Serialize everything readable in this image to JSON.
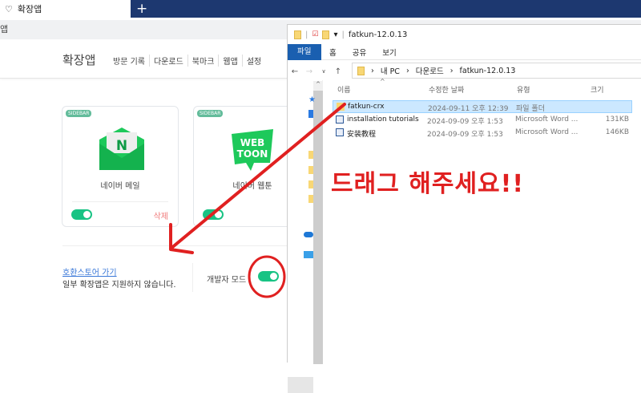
{
  "browser": {
    "tab_title": "확장앱",
    "new_tab": "+",
    "address": "앱"
  },
  "header": {
    "title": "확장앱",
    "nav": [
      "방문 기록",
      "다운로드",
      "북마크",
      "웹앱",
      "설정"
    ]
  },
  "cards": [
    {
      "badge": "SIDEBAR",
      "name": "네이버 메일",
      "enabled": true,
      "delete": "삭제",
      "logo": "N"
    },
    {
      "badge": "SIDEBAR",
      "name": "네이버 웹툰",
      "enabled": true,
      "logo": [
        "WEB",
        "TOON"
      ]
    }
  ],
  "footer": {
    "store_link": "호환스토어 가기",
    "note": "일부 확장앱은 지원하지 않습니다.",
    "dev_mode": "개발자 모드",
    "dev_enabled": true
  },
  "explorer": {
    "title": "fatkun-12.0.13",
    "ribbon": [
      "파일",
      "홈",
      "공유",
      "보기"
    ],
    "breadcrumb": [
      "내 PC",
      "다운로드",
      "fatkun-12.0.13"
    ],
    "columns": [
      "이름",
      "수정한 날짜",
      "유형",
      "크기"
    ],
    "files": [
      {
        "name": "fatkun-crx",
        "date": "2024-09-11 오후 12:39",
        "type": "파일 폴더",
        "size": "",
        "selected": true
      },
      {
        "name": "installation tutorials",
        "date": "2024-09-09 오후 1:53",
        "type": "Microsoft Word ...",
        "size": "131KB"
      },
      {
        "name": "安装教程",
        "date": "2024-09-09 오후 1:53",
        "type": "Microsoft Word ...",
        "size": "146KB"
      }
    ]
  },
  "annotation": {
    "text": "드래그 해주세요!!",
    "color": "#e02020"
  }
}
